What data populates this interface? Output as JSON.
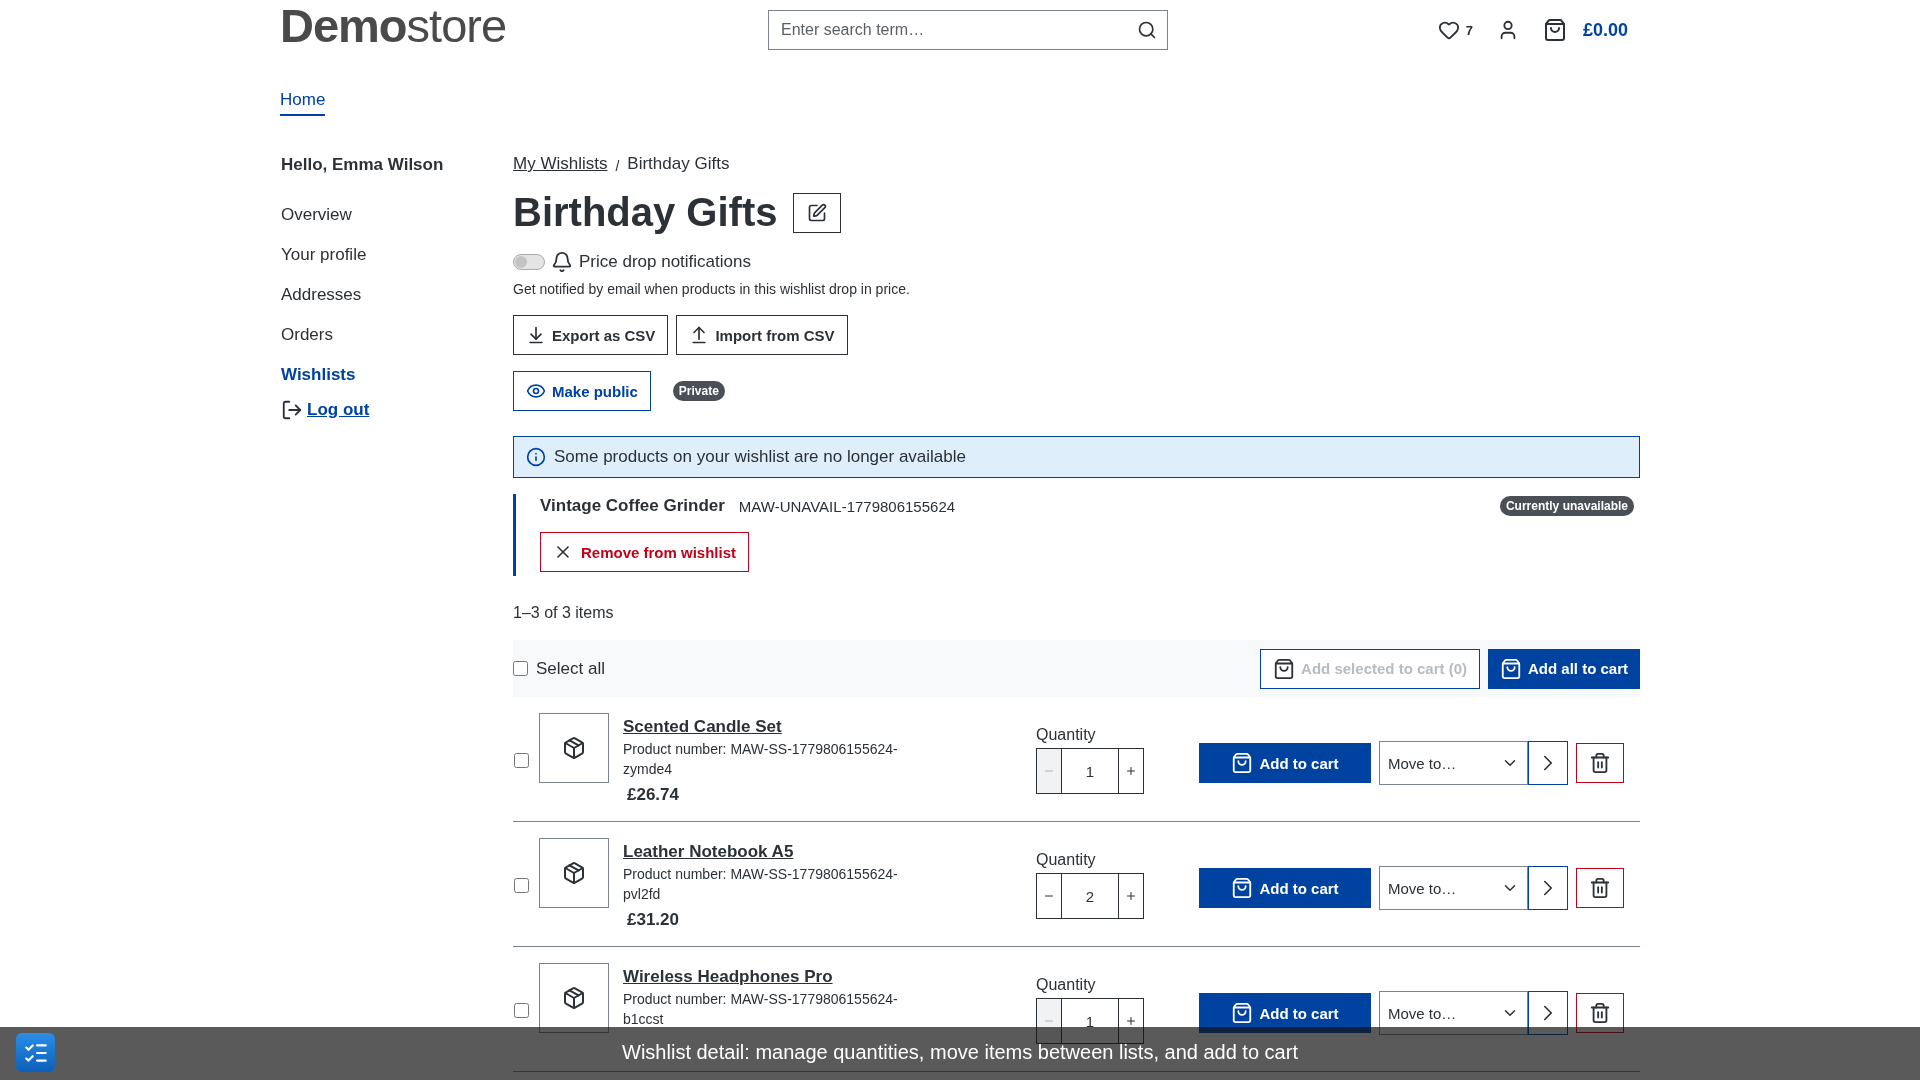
{
  "header": {
    "logo": "**Demo**store",
    "search": {
      "placeholder": "Enter search term…"
    },
    "wishlist_count": "7",
    "cart_total": "£0.00"
  },
  "nav": [
    {
      "label": "Home",
      "selected": true
    }
  ],
  "sidebar": {
    "greeting": "Hello, Emma Wilson",
    "items": [
      {
        "label": "Overview",
        "selected": false
      },
      {
        "label": "Your profile",
        "selected": false
      },
      {
        "label": "Addresses",
        "selected": false
      },
      {
        "label": "Orders",
        "selected": false
      },
      {
        "label": "Wishlists",
        "selected": true
      }
    ],
    "logout": "Log out"
  },
  "breadcrumb": [
    {
      "label": "My Wishlists",
      "kind": "link"
    },
    {
      "label": "Birthday Gifts",
      "kind": "current"
    }
  ],
  "breadcrumb_separator": "/",
  "title": "Birthday Gifts",
  "price_drop": {
    "label": "Price drop notifications",
    "on": false,
    "description": "Get notified by email when products in this wishlist drop in price."
  },
  "actions": [
    {
      "label": "Export as CSV",
      "kind": "export"
    },
    {
      "label": "Import from CSV",
      "kind": "import"
    }
  ],
  "visibility": {
    "button": "Make public",
    "badge": "Private"
  },
  "alert": "Some products on your wishlist are no longer available",
  "unavailable": [
    {
      "name": "Vintage Coffee Grinder",
      "number": "MAW-UNAVAIL-1779806155624",
      "badge": "Currently unavailable",
      "remove": "Remove from wishlist"
    }
  ],
  "count": "1–3 of 3 items",
  "bulk": {
    "select_all": "Select all",
    "checked": false,
    "add_selected": "Add selected to cart (0)",
    "add_selected_disabled": true,
    "add_all": "Add all to cart"
  },
  "items": [
    {
      "name": "Scented Candle Set",
      "number": "Product number: MAW-SS-1779806155624-zymde4",
      "price": "£26.74",
      "checked": false,
      "quantity_label": "Quantity",
      "quantity": "1",
      "decrease_disabled": true,
      "add_to_cart": "Add to cart",
      "move": "Move to…"
    },
    {
      "name": "Leather Notebook A5",
      "number": "Product number: MAW-SS-1779806155624-pvl2fd",
      "price": "£31.20",
      "checked": false,
      "quantity_label": "Quantity",
      "quantity": "2",
      "decrease_disabled": false,
      "add_to_cart": "Add to cart",
      "move": "Move to…"
    },
    {
      "name": "Wireless Headphones Pro",
      "number": "Product number: MAW-SS-1779806155624-b1ccst",
      "checked": false,
      "quantity_label": "Quantity",
      "quantity": "1",
      "decrease_disabled": true,
      "add_to_cart": "Add to cart",
      "move": "Move to…"
    }
  ],
  "caption": "Wishlist detail: manage quantities, move items between lists, and add to cart"
}
